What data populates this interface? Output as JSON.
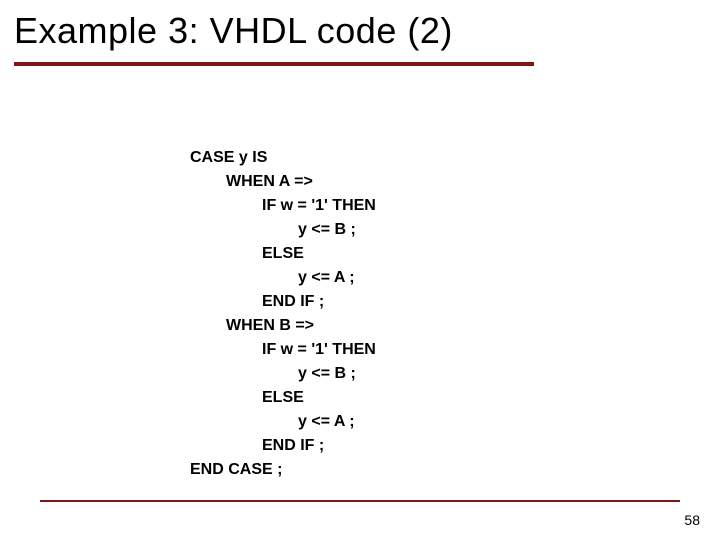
{
  "title": "Example 3: VHDL code (2)",
  "code": {
    "l0": "CASE y IS",
    "l1": "WHEN A =>",
    "l2": "IF w = '1' THEN",
    "l3": "y <= B ;",
    "l4": "ELSE",
    "l5": "y <= A ;",
    "l6": "END IF ;",
    "l7": "WHEN B =>",
    "l8": "IF w = '1' THEN",
    "l9": "y <= B ;",
    "l10": "ELSE",
    "l11": "y <= A ;",
    "l12": "END IF ;",
    "l13": "END CASE ;"
  },
  "page_number": "58"
}
